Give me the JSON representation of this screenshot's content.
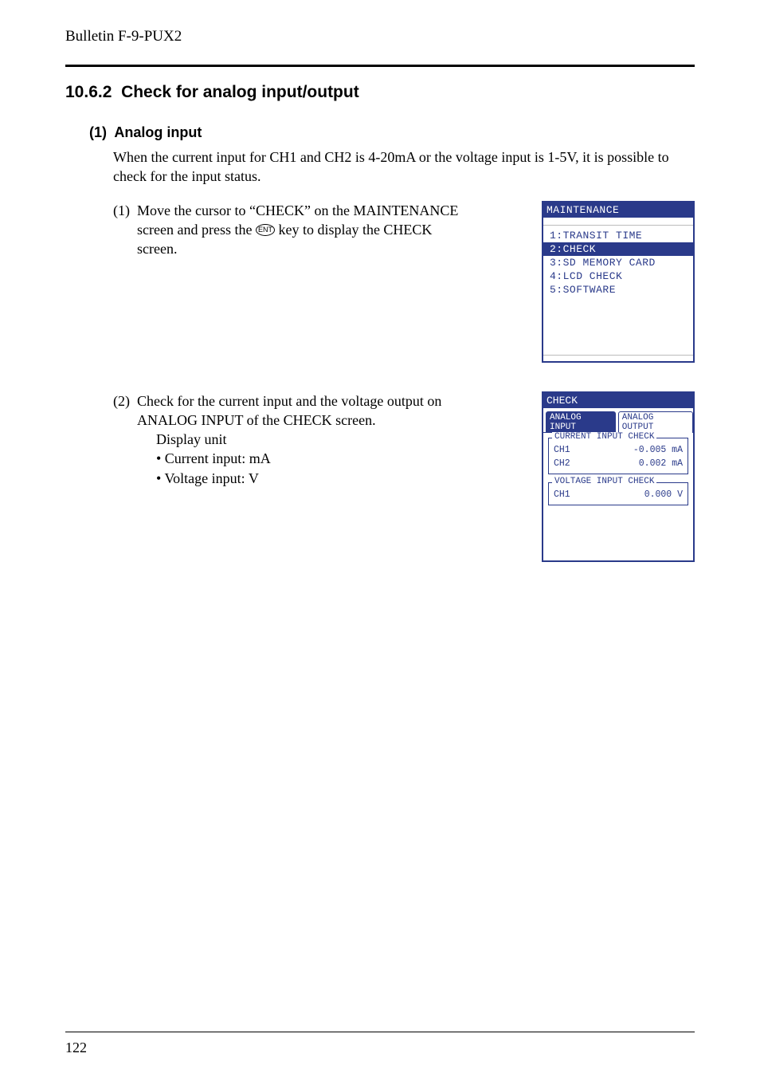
{
  "header": {
    "bulletin": "Bulletin F-9-PUX2"
  },
  "section": {
    "num": "10.6.2",
    "title": "Check for analog input/output",
    "sub_num": "(1)",
    "sub_title": "Analog input",
    "intro": "When the current input for CH1 and CH2 is 4-20mA or the voltage input is 1-5V, it is possible to check for the input status."
  },
  "steps": [
    {
      "num": "(1)",
      "text_a": "Move the cursor to “CHECK” on the MAINTENANCE",
      "text_b_pre": "screen and press the ",
      "ent": "ENT",
      "text_b_post": " key to display the CHECK",
      "text_c": "screen."
    },
    {
      "num": "(2)",
      "text_a": "Check for the current input and the voltage output on",
      "text_b": "ANALOG INPUT of the CHECK screen.",
      "line1": "Display unit",
      "bullet1": "• Current input: mA",
      "bullet2": "• Voltage input: V"
    }
  ],
  "lcd1": {
    "title": "MAINTENANCE",
    "items": [
      "1:TRANSIT TIME",
      "2:CHECK",
      "3:SD MEMORY CARD",
      "4:LCD CHECK",
      "5:SOFTWARE"
    ],
    "selected_index": 1
  },
  "lcd2": {
    "title": "CHECK",
    "tab_active": "ANALOG INPUT",
    "tab_inactive": "ANALOG OUTPUT",
    "group1": {
      "legend": "CURRENT INPUT CHECK",
      "rows": [
        {
          "label": "CH1",
          "value": "-0.005 mA"
        },
        {
          "label": "CH2",
          "value": "0.002 mA"
        }
      ]
    },
    "group2": {
      "legend": "VOLTAGE INPUT CHECK",
      "rows": [
        {
          "label": "CH1",
          "value": "0.000 V"
        }
      ]
    }
  },
  "footer": {
    "page": "122"
  }
}
